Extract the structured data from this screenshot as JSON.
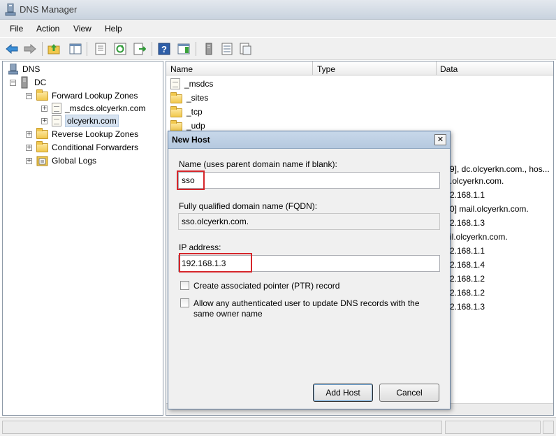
{
  "window": {
    "title": "DNS Manager"
  },
  "menu": [
    "File",
    "Action",
    "View",
    "Help"
  ],
  "toolbar": {
    "icons": [
      "back-arrow-icon",
      "forward-arrow-icon",
      "up-folder-icon",
      "show-hide-tree-icon",
      "properties-icon",
      "refresh-icon",
      "export-list-icon",
      "help-icon",
      "show-action-pane-icon",
      "server-icon",
      "list-icon",
      "folder-snapin-icon"
    ]
  },
  "tree": {
    "root": "DNS",
    "server": "DC",
    "forward_zones": "Forward Lookup Zones",
    "zone_msdcs": "_msdcs.olcyerkn.com",
    "zone_main": "olcyerkn.com",
    "reverse_zones": "Reverse Lookup Zones",
    "conditional_forwarders": "Conditional Forwarders",
    "global_logs": "Global Logs"
  },
  "list": {
    "columns": [
      "Name",
      "Type",
      "Data"
    ],
    "items": [
      "_msdcs",
      "_sites",
      "_tcp",
      "_udp"
    ],
    "data_values": [
      "9], dc.olcyerkn.com., hos...",
      ".olcyerkn.com.",
      "2.168.1.1",
      "0]  mail.olcyerkn.com.",
      "2.168.1.3",
      "il.olcyerkn.com.",
      "2.168.1.1",
      "2.168.1.4",
      "2.168.1.2",
      "2.168.1.2",
      "2.168.1.3"
    ]
  },
  "dialog": {
    "title": "New Host",
    "close_label": "✕",
    "name_label": "Name (uses parent domain name if blank):",
    "name_value": "sso",
    "fqdn_label": "Fully qualified domain name (FQDN):",
    "fqdn_value": "sso.olcyerkn.com.",
    "ip_label": "IP address:",
    "ip_value": "192.168.1.3",
    "ptr_label": "Create associated pointer (PTR) record",
    "allow_label_line1": "Allow any authenticated user to update DNS records with the",
    "allow_label_line2": "same owner name",
    "add_button": "Add Host",
    "cancel_button": "Cancel"
  },
  "colors": {
    "highlight": "#d6262b",
    "title_gradient": "#b5c9df"
  }
}
